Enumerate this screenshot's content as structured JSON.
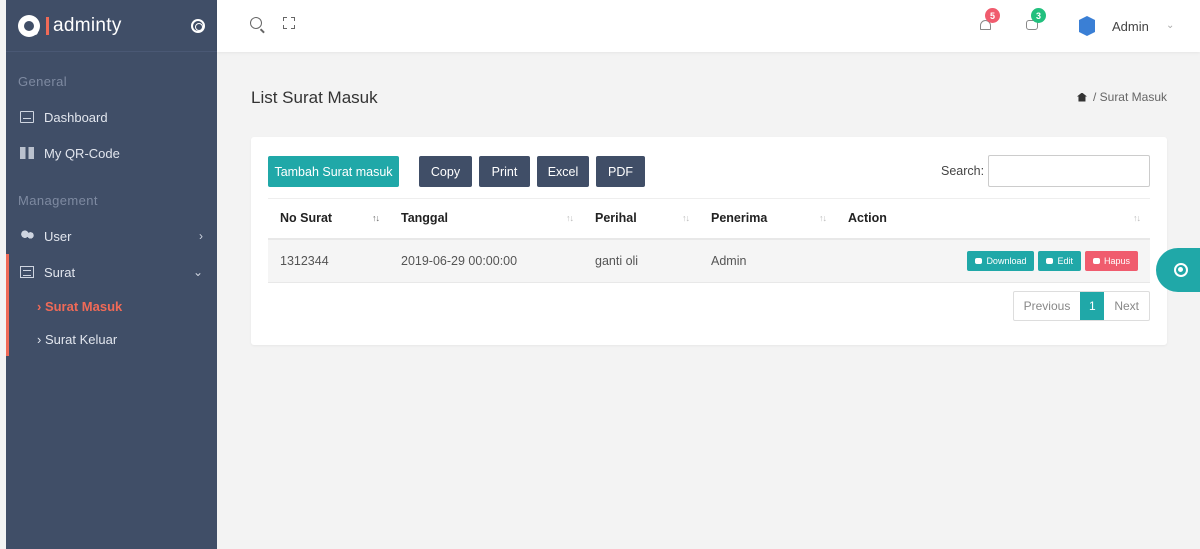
{
  "brand": {
    "name": "adminty"
  },
  "sidebar": {
    "sections": [
      {
        "title": "General"
      },
      {
        "title": "Management"
      }
    ],
    "items": [
      {
        "label": "Dashboard",
        "icon": "dashboard-icon"
      },
      {
        "label": "My QR-Code",
        "icon": "qr-code-icon"
      },
      {
        "label": "User",
        "icon": "users-icon",
        "chevron": "›"
      },
      {
        "label": "Surat",
        "icon": "mail-icon",
        "chevron": "⌄"
      }
    ],
    "subitems": [
      {
        "label": "› Surat Masuk",
        "active": true
      },
      {
        "label": "› Surat Keluar",
        "active": false
      }
    ]
  },
  "topbar": {
    "notifications_count": "5",
    "messages_count": "3",
    "user_name": "Admin",
    "user_chevron": "⌄"
  },
  "page": {
    "title": "List Surat Masuk",
    "breadcrumb": "/ Surat Masuk"
  },
  "toolbar": {
    "add_label": "Tambah Surat masuk",
    "copy_label": "Copy",
    "print_label": "Print",
    "excel_label": "Excel",
    "pdf_label": "PDF",
    "search_label": "Search:",
    "search_value": ""
  },
  "table": {
    "columns": [
      "No Surat",
      "Tanggal",
      "Perihal",
      "Penerima",
      "Action"
    ],
    "rows": [
      {
        "no_surat": "1312344",
        "tanggal": "2019-06-29 00:00:00",
        "perihal": "ganti oli",
        "penerima": "Admin"
      }
    ],
    "actions": {
      "download": "Download",
      "edit": "Edit",
      "hapus": "Hapus"
    }
  },
  "pagination": {
    "previous": "Previous",
    "current": "1",
    "next": "Next"
  },
  "colors": {
    "sidebar": "#404e67",
    "accent": "#20a8a8",
    "danger": "#f05c6e",
    "highlight": "#f06a57"
  }
}
